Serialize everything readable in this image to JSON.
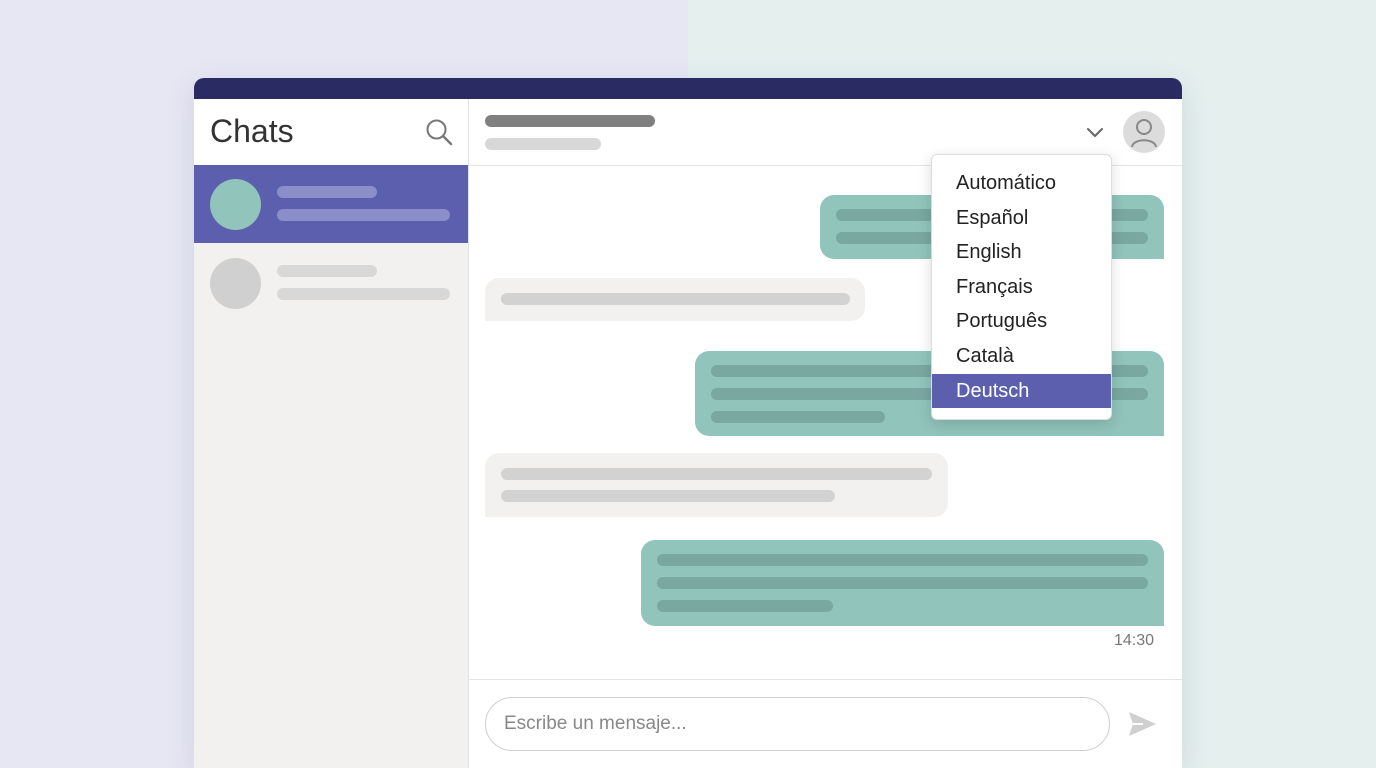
{
  "sidebar": {
    "title": "Chats",
    "search_icon": "search-icon",
    "active_color": "#5b5fae"
  },
  "conversation": {
    "timestamp": "14:30",
    "outgoing_color": "#91c4bb",
    "incoming_color": "#f2f1ef"
  },
  "composer": {
    "placeholder": "Escribe un mensaje...",
    "send_icon": "send-icon"
  },
  "language_menu": {
    "toggle_icon": "chevron-down-icon",
    "options": [
      {
        "label": "Automático"
      },
      {
        "label": "Español"
      },
      {
        "label": "English"
      },
      {
        "label": "Français"
      },
      {
        "label": "Português"
      },
      {
        "label": "Català"
      },
      {
        "label": "Deutsch"
      }
    ],
    "selected_label": "Deutsch"
  },
  "header": {
    "user_icon": "user-avatar-icon"
  }
}
